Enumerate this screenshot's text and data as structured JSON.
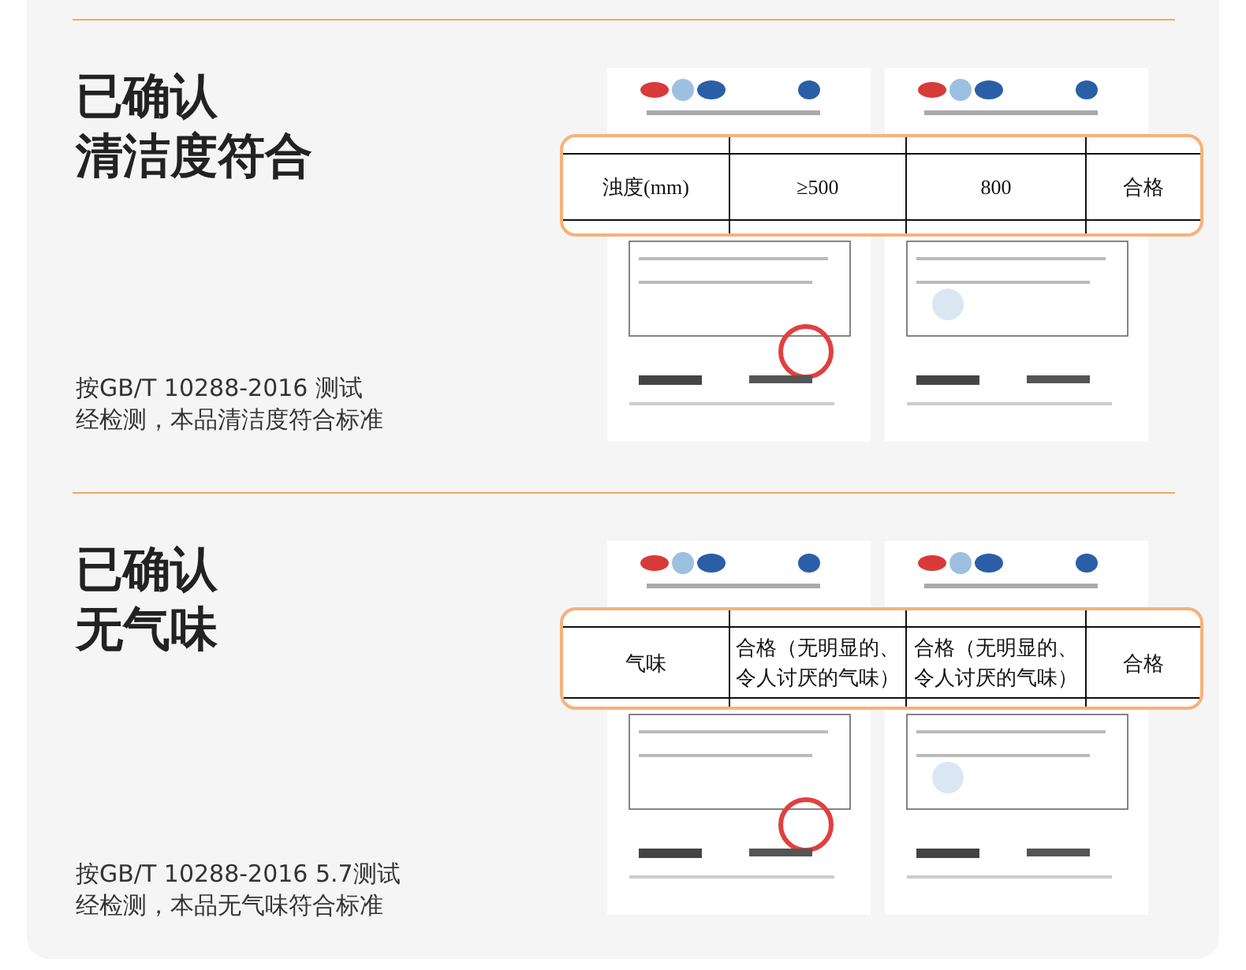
{
  "sections": [
    {
      "title_lines": [
        "已确认",
        "清洁度符合"
      ],
      "description_lines": [
        "按GB/T 10288-2016 测试",
        "经检测，本品清洁度符合标准"
      ],
      "highlight_row": [
        "浊度(mm)",
        "≥500",
        "800",
        "合格"
      ]
    },
    {
      "title_lines": [
        "已确认",
        "无气味"
      ],
      "description_lines": [
        "按GB/T 10288-2016 5.7测试",
        "经检测，本品无气味符合标准"
      ],
      "highlight_row": [
        "气味",
        "合格（无明显的、令人讨厌的气味）",
        "合格（无明显的、令人讨厌的气味）",
        "合格"
      ]
    }
  ]
}
